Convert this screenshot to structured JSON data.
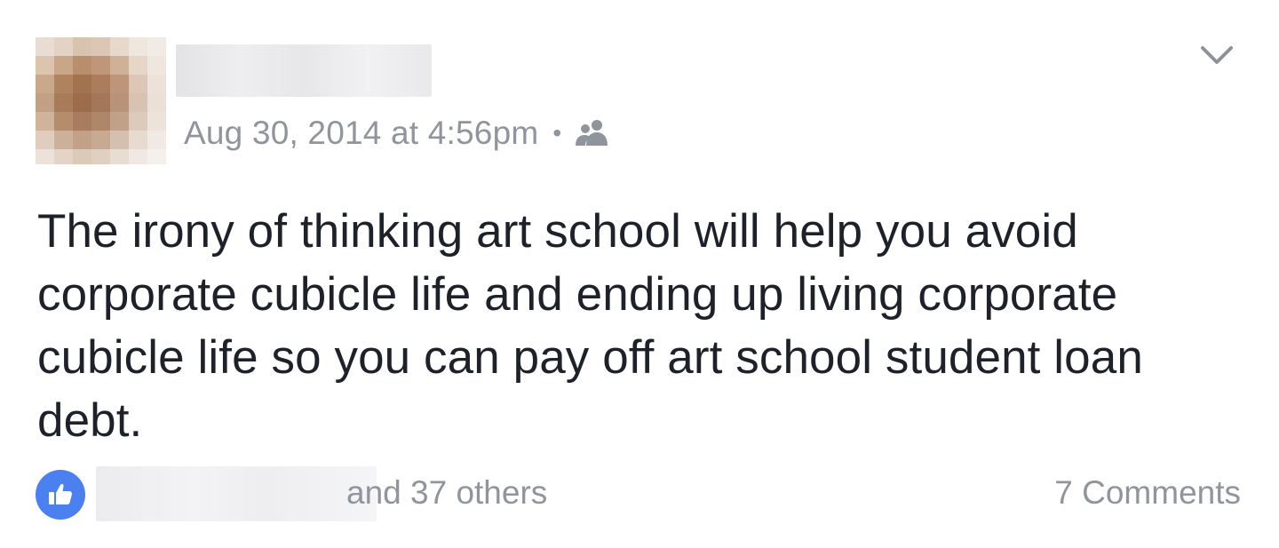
{
  "post": {
    "timestamp": "Aug 30, 2014 at 4:56pm",
    "separator": "•",
    "audience_icon": "friends-icon",
    "menu_icon": "chevron-down-icon",
    "body": "The irony of thinking art school will help you avoid corporate cubicle life and ending up living corporate cubicle life so you can pay off art school student loan debt."
  },
  "reactions": {
    "icon": "like-icon",
    "others_label": "and 37 others",
    "comments_label": "7 Comments"
  },
  "colors": {
    "like_blue": "#4a80f0",
    "meta_gray": "#90949c",
    "text_dark": "#1d2129"
  }
}
